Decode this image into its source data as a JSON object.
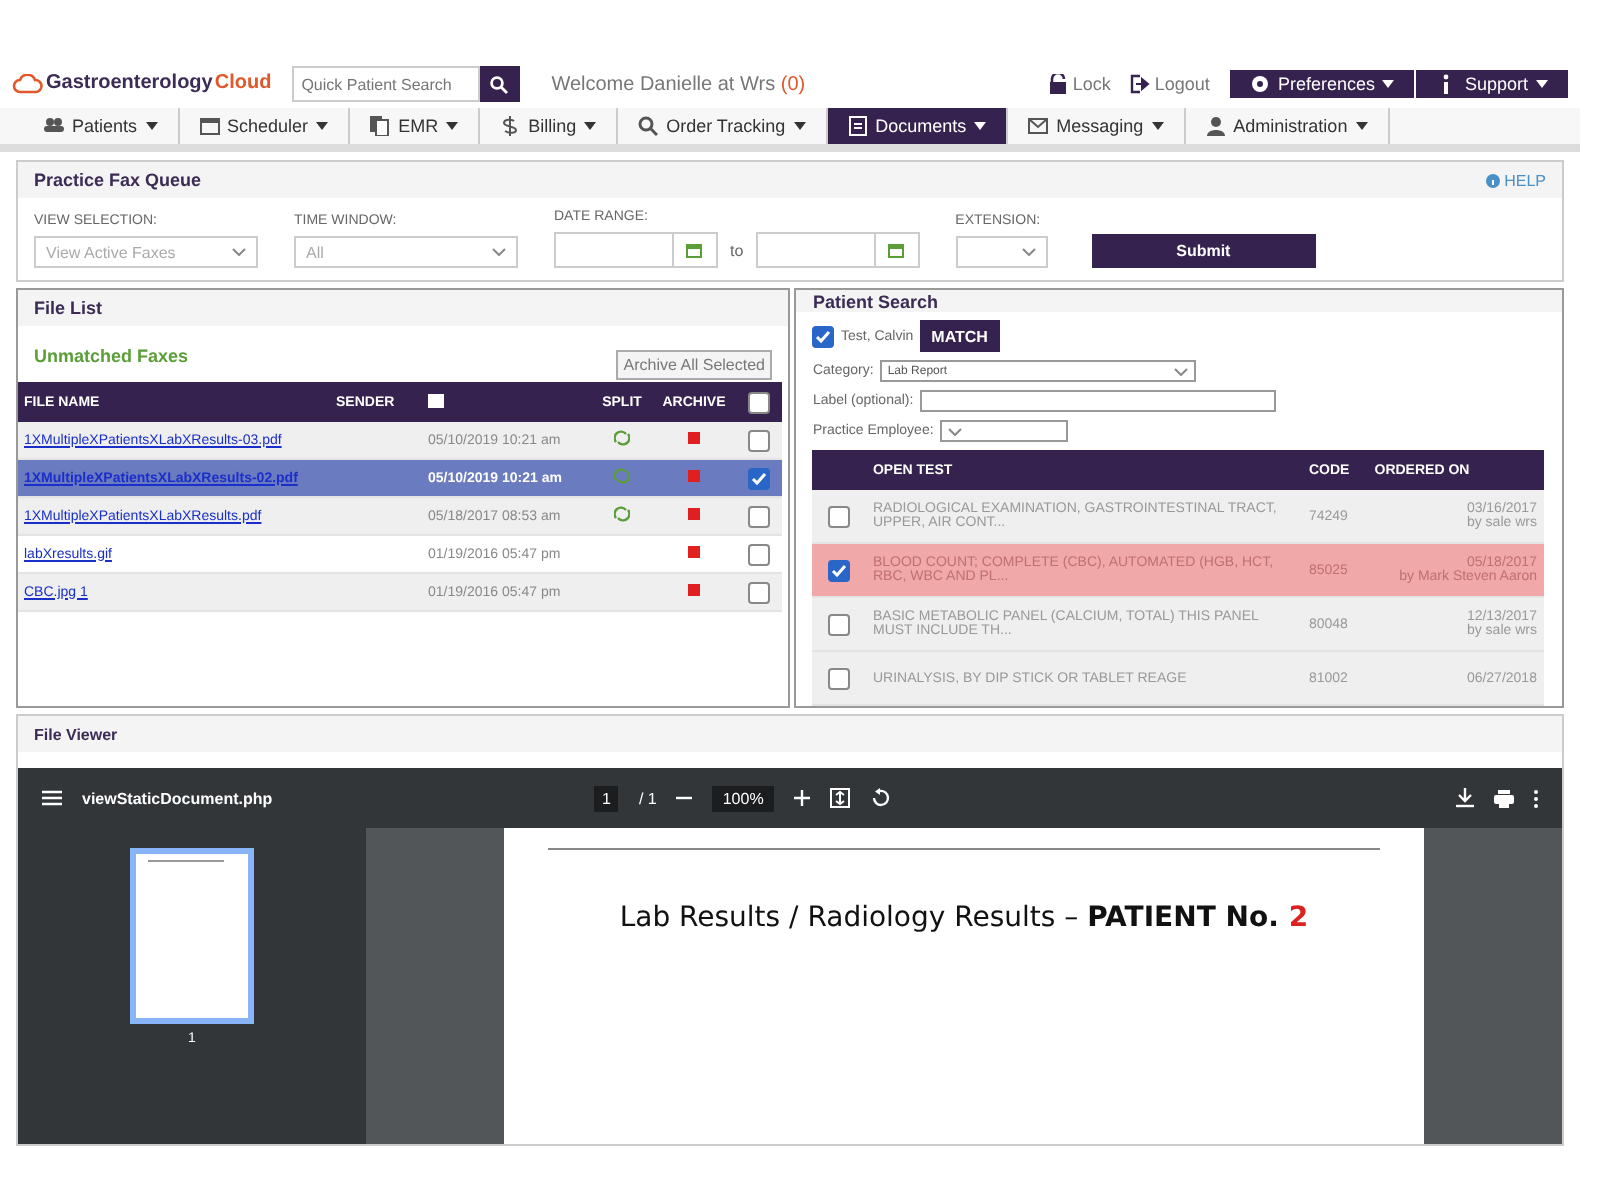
{
  "header": {
    "logo": {
      "name": "Gastroenterology",
      "suffix": "Cloud"
    },
    "search": {
      "placeholder": "Quick Patient Search"
    },
    "welcome": "Welcome Danielle at Wrs",
    "count": "(0)",
    "links": [
      {
        "kind": "lock",
        "label": "Lock"
      },
      {
        "kind": "logout",
        "label": "Logout"
      }
    ],
    "buttons": [
      {
        "kind": "gear",
        "label": "Preferences"
      },
      {
        "kind": "info",
        "label": "Support"
      }
    ]
  },
  "nav": [
    {
      "kind": "users",
      "label": "Patients",
      "selected": false
    },
    {
      "kind": "calendar",
      "label": "Scheduler",
      "selected": false
    },
    {
      "kind": "copy",
      "label": "EMR",
      "selected": false
    },
    {
      "kind": "dollar",
      "label": "Billing",
      "selected": false
    },
    {
      "kind": "search",
      "label": "Order Tracking",
      "selected": false
    },
    {
      "kind": "doc",
      "label": "Documents",
      "selected": true
    },
    {
      "kind": "mail",
      "label": "Messaging",
      "selected": false
    },
    {
      "kind": "user",
      "label": "Administration",
      "selected": false
    }
  ],
  "fax_queue": {
    "title": "Practice Fax Queue",
    "help": "HELP",
    "fields": [
      {
        "kind": "select",
        "label": "VIEW SELECTION:",
        "value": "View Active Faxes"
      },
      {
        "kind": "select",
        "label": "TIME WINDOW:",
        "value": "All"
      },
      {
        "kind": "daterange",
        "label": "DATE RANGE:",
        "joiner": "to"
      },
      {
        "kind": "select",
        "label": "EXTENSION:"
      }
    ],
    "submit": "Submit"
  },
  "file_list": {
    "title": "File List",
    "subtitle": "Unmatched Faxes",
    "archive_button": "Archive All Selected",
    "columns": {
      "file": "FILE NAME",
      "sender": "SENDER",
      "split": "SPLIT",
      "archive": "ARCHIVE"
    },
    "all_checked": false,
    "rows": [
      {
        "file": "1XMultipleXPatientsXLabXResults-03.pdf",
        "date": "05/10/2019 10:21 am",
        "split": true,
        "checked": false,
        "selected": false
      },
      {
        "file": "1XMultipleXPatientsXLabXResults-02.pdf",
        "date": "05/10/2019 10:21 am",
        "split": true,
        "checked": true,
        "selected": true
      },
      {
        "file": "1XMultipleXPatientsXLabXResults.pdf",
        "date": "05/18/2017 08:53 am",
        "split": true,
        "checked": false,
        "selected": false
      },
      {
        "file": "labXresults.gif",
        "date": "01/19/2016 05:47 pm",
        "split": false,
        "checked": false,
        "selected": false
      },
      {
        "file": "CBC.jpg 1",
        "date": "01/19/2016 05:47 pm",
        "split": false,
        "checked": false,
        "selected": false
      }
    ]
  },
  "patient_search": {
    "title": "Patient Search",
    "patient": {
      "label": "Test, Calvin",
      "checked": true
    },
    "match": "MATCH",
    "category": {
      "label": "Category:",
      "value": "Lab Report"
    },
    "label_field": {
      "label": "Label (optional):"
    },
    "employee": {
      "label": "Practice Employee:"
    },
    "columns": {
      "test": "OPEN TEST",
      "code": "CODE",
      "ordered": "ORDERED ON"
    },
    "rows": [
      {
        "test": "RADIOLOGICAL EXAMINATION, GASTROINTESTINAL TRACT, UPPER, AIR CONT...",
        "code": "74249",
        "date": "03/16/2017",
        "by": "by sale wrs",
        "checked": false
      },
      {
        "test": "BLOOD COUNT; COMPLETE (CBC), AUTOMATED (HGB, HCT, RBC, WBC AND PL...",
        "code": "85025",
        "date": "05/18/2017",
        "by": "by Mark Steven Aaron",
        "checked": true
      },
      {
        "test": "BASIC METABOLIC PANEL (CALCIUM, TOTAL) THIS PANEL MUST INCLUDE TH...",
        "code": "80048",
        "date": "12/13/2017",
        "by": "by sale wrs",
        "checked": false
      },
      {
        "test": "URINALYSIS, BY DIP STICK OR TABLET REAGE",
        "code": "81002",
        "date": "06/27/2018",
        "checked": false
      }
    ]
  },
  "file_viewer": {
    "title": "File Viewer",
    "toolbar": {
      "filename": "viewStaticDocument.php",
      "page": "1",
      "pages": "/ 1",
      "zoom": "100%"
    },
    "thumbnail_label": "1",
    "document": {
      "heading": "Lab Results / Radiology Results – **PATIENT No.**",
      "number": "2"
    }
  }
}
